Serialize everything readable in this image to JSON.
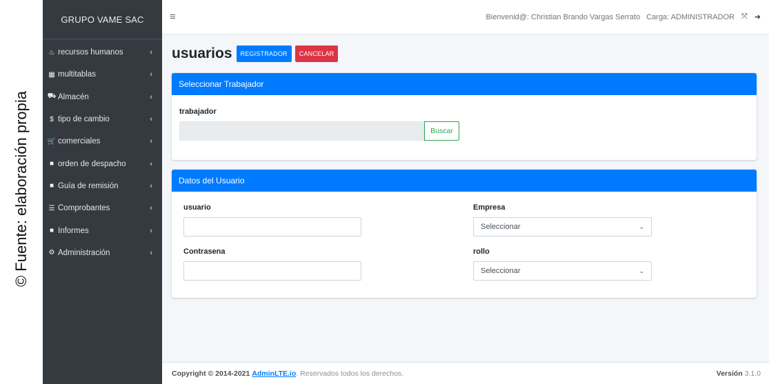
{
  "credit": "© Fuente: elaboración propia",
  "sidebar": {
    "brand": "GRUPO VAME SAC",
    "items": [
      {
        "icon": "♨",
        "label": "recursos humanos",
        "name": "recursos-humanos"
      },
      {
        "icon": "▦",
        "label": "multitablas",
        "name": "multitablas"
      },
      {
        "icon": "⛟",
        "label": "Almacén",
        "name": "almacen"
      },
      {
        "icon": "$",
        "label": "tipo de cambio",
        "name": "tipo-de-cambio"
      },
      {
        "icon": "🛒",
        "label": "comerciales",
        "name": "comerciales"
      },
      {
        "icon": "■",
        "label": "orden de despacho",
        "name": "orden-de-despacho"
      },
      {
        "icon": "■",
        "label": "Guía de remisión",
        "name": "guia-de-remision"
      },
      {
        "icon": "☰",
        "label": "Comprobantes",
        "name": "comprobantes"
      },
      {
        "icon": "■",
        "label": "Informes",
        "name": "informes"
      },
      {
        "icon": "⚙",
        "label": "Administración",
        "name": "administracion"
      }
    ],
    "caret": "‹"
  },
  "topbar": {
    "menu_icon": "≡",
    "welcome": "Bienvenid@: Christian Brando Vargas Serrato",
    "role": "Carga: ADMINISTRADOR",
    "fullscreen_icon": "⤧",
    "logout_icon": "➜"
  },
  "page": {
    "title": "usuarios",
    "register_label": "REGISTRADOR",
    "cancel_label": "CANCELAR"
  },
  "trabajador_card": {
    "header": "Seleccionar Trabajador",
    "field_label": "trabajador",
    "field_value": "",
    "search_label": "Buscar"
  },
  "usuario_card": {
    "header": "Datos del Usuario",
    "usuario_label": "usuario",
    "usuario_value": "",
    "contrasena_label": "Contrasena",
    "contrasena_value": "",
    "empresa_label": "Empresa",
    "empresa_value": "Seleccionar",
    "rollo_label": "rollo",
    "rollo_value": "Seleccionar"
  },
  "footer": {
    "copyright": "Copyright © 2014-2021",
    "link": "AdminLTE.io",
    "rights": ". Reservados todos los derechos.",
    "version_label": "Versión",
    "version_number": "3.1.0"
  },
  "colors": {
    "primary": "#007bff",
    "danger": "#dc3545",
    "success": "#28a745",
    "sidebar": "#343a40"
  }
}
